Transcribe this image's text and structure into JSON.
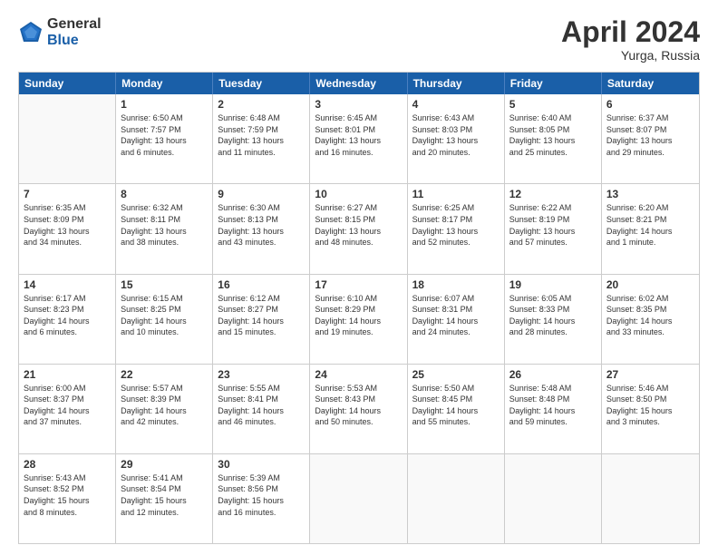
{
  "logo": {
    "general": "General",
    "blue": "Blue"
  },
  "title": "April 2024",
  "location": "Yurga, Russia",
  "days_of_week": [
    "Sunday",
    "Monday",
    "Tuesday",
    "Wednesday",
    "Thursday",
    "Friday",
    "Saturday"
  ],
  "weeks": [
    [
      {
        "day": "",
        "empty": true,
        "lines": []
      },
      {
        "day": "1",
        "empty": false,
        "lines": [
          "Sunrise: 6:50 AM",
          "Sunset: 7:57 PM",
          "Daylight: 13 hours",
          "and 6 minutes."
        ]
      },
      {
        "day": "2",
        "empty": false,
        "lines": [
          "Sunrise: 6:48 AM",
          "Sunset: 7:59 PM",
          "Daylight: 13 hours",
          "and 11 minutes."
        ]
      },
      {
        "day": "3",
        "empty": false,
        "lines": [
          "Sunrise: 6:45 AM",
          "Sunset: 8:01 PM",
          "Daylight: 13 hours",
          "and 16 minutes."
        ]
      },
      {
        "day": "4",
        "empty": false,
        "lines": [
          "Sunrise: 6:43 AM",
          "Sunset: 8:03 PM",
          "Daylight: 13 hours",
          "and 20 minutes."
        ]
      },
      {
        "day": "5",
        "empty": false,
        "lines": [
          "Sunrise: 6:40 AM",
          "Sunset: 8:05 PM",
          "Daylight: 13 hours",
          "and 25 minutes."
        ]
      },
      {
        "day": "6",
        "empty": false,
        "lines": [
          "Sunrise: 6:37 AM",
          "Sunset: 8:07 PM",
          "Daylight: 13 hours",
          "and 29 minutes."
        ]
      }
    ],
    [
      {
        "day": "7",
        "empty": false,
        "lines": [
          "Sunrise: 6:35 AM",
          "Sunset: 8:09 PM",
          "Daylight: 13 hours",
          "and 34 minutes."
        ]
      },
      {
        "day": "8",
        "empty": false,
        "lines": [
          "Sunrise: 6:32 AM",
          "Sunset: 8:11 PM",
          "Daylight: 13 hours",
          "and 38 minutes."
        ]
      },
      {
        "day": "9",
        "empty": false,
        "lines": [
          "Sunrise: 6:30 AM",
          "Sunset: 8:13 PM",
          "Daylight: 13 hours",
          "and 43 minutes."
        ]
      },
      {
        "day": "10",
        "empty": false,
        "lines": [
          "Sunrise: 6:27 AM",
          "Sunset: 8:15 PM",
          "Daylight: 13 hours",
          "and 48 minutes."
        ]
      },
      {
        "day": "11",
        "empty": false,
        "lines": [
          "Sunrise: 6:25 AM",
          "Sunset: 8:17 PM",
          "Daylight: 13 hours",
          "and 52 minutes."
        ]
      },
      {
        "day": "12",
        "empty": false,
        "lines": [
          "Sunrise: 6:22 AM",
          "Sunset: 8:19 PM",
          "Daylight: 13 hours",
          "and 57 minutes."
        ]
      },
      {
        "day": "13",
        "empty": false,
        "lines": [
          "Sunrise: 6:20 AM",
          "Sunset: 8:21 PM",
          "Daylight: 14 hours",
          "and 1 minute."
        ]
      }
    ],
    [
      {
        "day": "14",
        "empty": false,
        "lines": [
          "Sunrise: 6:17 AM",
          "Sunset: 8:23 PM",
          "Daylight: 14 hours",
          "and 6 minutes."
        ]
      },
      {
        "day": "15",
        "empty": false,
        "lines": [
          "Sunrise: 6:15 AM",
          "Sunset: 8:25 PM",
          "Daylight: 14 hours",
          "and 10 minutes."
        ]
      },
      {
        "day": "16",
        "empty": false,
        "lines": [
          "Sunrise: 6:12 AM",
          "Sunset: 8:27 PM",
          "Daylight: 14 hours",
          "and 15 minutes."
        ]
      },
      {
        "day": "17",
        "empty": false,
        "lines": [
          "Sunrise: 6:10 AM",
          "Sunset: 8:29 PM",
          "Daylight: 14 hours",
          "and 19 minutes."
        ]
      },
      {
        "day": "18",
        "empty": false,
        "lines": [
          "Sunrise: 6:07 AM",
          "Sunset: 8:31 PM",
          "Daylight: 14 hours",
          "and 24 minutes."
        ]
      },
      {
        "day": "19",
        "empty": false,
        "lines": [
          "Sunrise: 6:05 AM",
          "Sunset: 8:33 PM",
          "Daylight: 14 hours",
          "and 28 minutes."
        ]
      },
      {
        "day": "20",
        "empty": false,
        "lines": [
          "Sunrise: 6:02 AM",
          "Sunset: 8:35 PM",
          "Daylight: 14 hours",
          "and 33 minutes."
        ]
      }
    ],
    [
      {
        "day": "21",
        "empty": false,
        "lines": [
          "Sunrise: 6:00 AM",
          "Sunset: 8:37 PM",
          "Daylight: 14 hours",
          "and 37 minutes."
        ]
      },
      {
        "day": "22",
        "empty": false,
        "lines": [
          "Sunrise: 5:57 AM",
          "Sunset: 8:39 PM",
          "Daylight: 14 hours",
          "and 42 minutes."
        ]
      },
      {
        "day": "23",
        "empty": false,
        "lines": [
          "Sunrise: 5:55 AM",
          "Sunset: 8:41 PM",
          "Daylight: 14 hours",
          "and 46 minutes."
        ]
      },
      {
        "day": "24",
        "empty": false,
        "lines": [
          "Sunrise: 5:53 AM",
          "Sunset: 8:43 PM",
          "Daylight: 14 hours",
          "and 50 minutes."
        ]
      },
      {
        "day": "25",
        "empty": false,
        "lines": [
          "Sunrise: 5:50 AM",
          "Sunset: 8:45 PM",
          "Daylight: 14 hours",
          "and 55 minutes."
        ]
      },
      {
        "day": "26",
        "empty": false,
        "lines": [
          "Sunrise: 5:48 AM",
          "Sunset: 8:48 PM",
          "Daylight: 14 hours",
          "and 59 minutes."
        ]
      },
      {
        "day": "27",
        "empty": false,
        "lines": [
          "Sunrise: 5:46 AM",
          "Sunset: 8:50 PM",
          "Daylight: 15 hours",
          "and 3 minutes."
        ]
      }
    ],
    [
      {
        "day": "28",
        "empty": false,
        "lines": [
          "Sunrise: 5:43 AM",
          "Sunset: 8:52 PM",
          "Daylight: 15 hours",
          "and 8 minutes."
        ]
      },
      {
        "day": "29",
        "empty": false,
        "lines": [
          "Sunrise: 5:41 AM",
          "Sunset: 8:54 PM",
          "Daylight: 15 hours",
          "and 12 minutes."
        ]
      },
      {
        "day": "30",
        "empty": false,
        "lines": [
          "Sunrise: 5:39 AM",
          "Sunset: 8:56 PM",
          "Daylight: 15 hours",
          "and 16 minutes."
        ]
      },
      {
        "day": "",
        "empty": true,
        "lines": []
      },
      {
        "day": "",
        "empty": true,
        "lines": []
      },
      {
        "day": "",
        "empty": true,
        "lines": []
      },
      {
        "day": "",
        "empty": true,
        "lines": []
      }
    ]
  ]
}
